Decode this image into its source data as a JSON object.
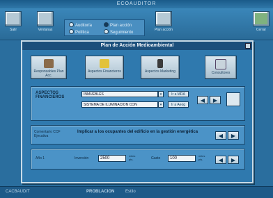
{
  "window": {
    "title": "ECOAUDITOR"
  },
  "toolbar": {
    "salir": "Salir",
    "ventanas": "Ventanas",
    "plan_accion": "Plan acción",
    "close": "Cerrar",
    "radios": [
      {
        "label": "Auditoría",
        "checked": false
      },
      {
        "label": "Plan acción",
        "checked": true
      },
      {
        "label": "Política",
        "checked": false
      },
      {
        "label": "Seguimiento",
        "checked": false
      }
    ]
  },
  "dialog": {
    "title": "Plan de Acción Medioambiental",
    "buttons": [
      "Responsables Plan Acc.",
      "Aspectos Financieros",
      "Aspectos Marketing",
      "Consultores"
    ]
  },
  "financial": {
    "label": "ASPECTOS FINANCIEROS",
    "field1": "INMUEBLES",
    "field2": "SISTEMA DE ILUMINACION CON",
    "btn_mda": "Ir a MDA",
    "btn_aeog": "Ir a Aeog"
  },
  "comment": {
    "label": "Comentario CCF Ejecutiva",
    "text": "Implicar a los ocupantes del edificio en la gestión energética"
  },
  "year": {
    "label": "Año 1",
    "inversion_label": "Inversión",
    "inversion_value": "2500",
    "inversion_unit": "miles pts.",
    "gasto_label": "Gasto",
    "gasto_value": "100",
    "gasto_unit": "miles pts."
  },
  "arrows": {
    "prev": "◀",
    "next": "▶"
  },
  "status": {
    "left": "CACBAUDIT",
    "mid": "PROBLACION",
    "right": "Estilo"
  }
}
